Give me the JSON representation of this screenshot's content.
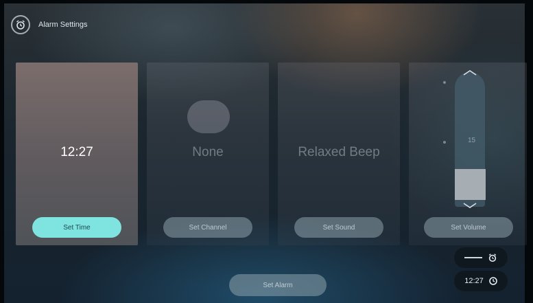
{
  "header": {
    "title": "Alarm Settings",
    "icon": "alarm-clock-icon"
  },
  "cards": [
    {
      "value": "12:27",
      "button": "Set Time",
      "active": true
    },
    {
      "value": "None",
      "button": "Set Channel",
      "active": false
    },
    {
      "value": "Relaxed Beep",
      "button": "Set Sound",
      "active": false
    },
    {
      "value": "15",
      "button": "Set Volume",
      "active": false
    }
  ],
  "bottom": {
    "set_alarm_label": "Set Alarm"
  },
  "status_widget": {
    "time": "12:27",
    "alarm_icon": "alarm-clock-icon",
    "clock_icon": "clock-icon"
  },
  "colors": {
    "accent": "#7fe3e0",
    "active_card": "#6f6566"
  }
}
